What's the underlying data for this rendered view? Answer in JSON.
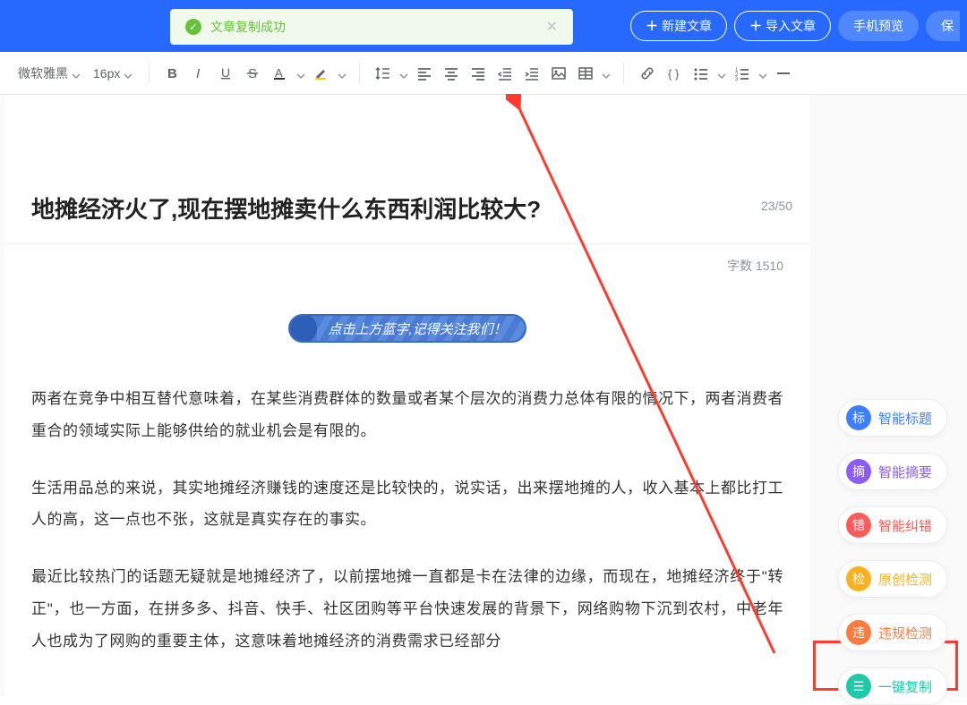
{
  "topbar": {
    "new_article": "新建文章",
    "import_article": "导入文章",
    "preview": "手机预览",
    "save": "保"
  },
  "toast": {
    "message": "文章复制成功"
  },
  "toolbar": {
    "font_family": "微软雅黑",
    "font_size": "16px"
  },
  "editor": {
    "title": "地摊经济火了,现在摆地摊卖什么东西利润比较大?",
    "title_count": "23/50",
    "word_count_label": "字数 1510",
    "banner": "点击上方蓝字,记得关注我们！",
    "paragraphs": [
      "两者在竞争中相互替代意味着，在某些消费群体的数量或者某个层次的消费力总体有限的情况下，两者消费者重合的领域实际上能够供给的就业机会是有限的。",
      "生活用品总的来说，其实地摊经济赚钱的速度还是比较快的，说实话，出来摆地摊的人，收入基本上都比打工人的高，这一点也不张，这就是真实存在的事实。",
      "最近比较热门的话题无疑就是地摊经济了，以前摆地摊一直都是卡在法律的边缘，而现在，地摊经济终于\"转正\"，也一方面，在拼多多、抖音、快手、社区团购等平台快速发展的背景下，网络购物下沉到农村，中老年人也成为了网购的重要主体，这意味着地摊经济的消费需求已经部分"
    ]
  },
  "side": {
    "items": [
      {
        "badge": "标",
        "label": "智能标题",
        "circle": "c-blue",
        "text": "t-blue"
      },
      {
        "badge": "摘",
        "label": "智能摘要",
        "circle": "c-purple",
        "text": "t-purple"
      },
      {
        "badge": "错",
        "label": "智能纠错",
        "circle": "c-red",
        "text": "t-red"
      },
      {
        "badge": "检",
        "label": "原创检测",
        "circle": "c-yellow",
        "text": "t-yellow"
      },
      {
        "badge": "违",
        "label": "违规检测",
        "circle": "c-orange",
        "text": "t-orange"
      },
      {
        "badge": "☰",
        "label": "一键复制",
        "circle": "c-teal",
        "text": "t-teal"
      }
    ]
  }
}
